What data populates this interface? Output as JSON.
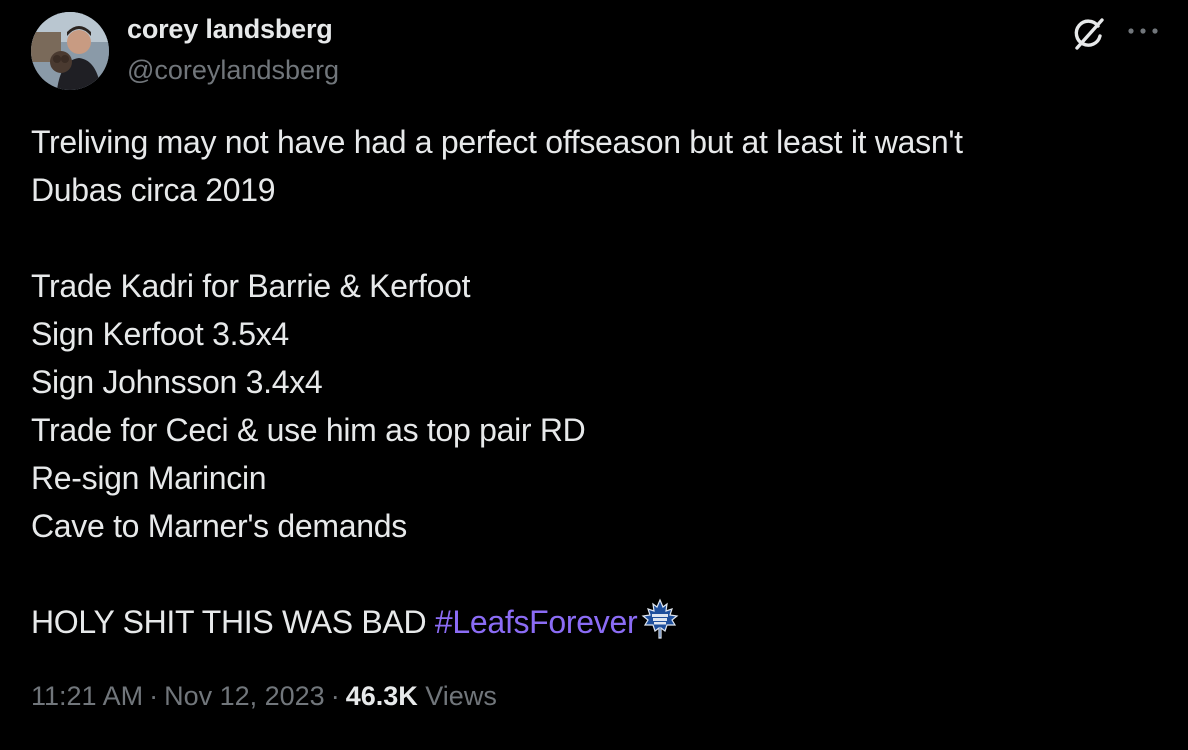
{
  "author": {
    "display_name": "corey landsberg",
    "handle": "@coreylandsberg",
    "avatar_icon": "profile-photo"
  },
  "actions": {
    "grok_icon": "grok-icon",
    "more_icon": "more-dots-icon"
  },
  "tweet": {
    "lines": [
      "Treliving may not have had a perfect offseason but at least it wasn't",
      "Dubas circa 2019",
      "",
      "Trade Kadri for Barrie & Kerfoot",
      "Sign Kerfoot 3.5x4",
      "Sign Johnsson 3.4x4",
      "Trade for Ceci & use him as top pair RD",
      "Re-sign Marincin",
      "Cave to Marner's demands",
      ""
    ],
    "last_line_text": "HOLY SHIT THIS WAS BAD ",
    "hashtag": "#LeafsForever",
    "hashflag_icon": "maple-leafs-logo-icon",
    "hashtag_color": "#8b6cf5"
  },
  "meta": {
    "time": "11:21 AM",
    "date": "Nov 12, 2023",
    "separator": "·",
    "views_count": "46.3K",
    "views_label": "Views"
  },
  "colors": {
    "background": "#000000",
    "primary_text": "#e7e9ea",
    "secondary_text": "#71767b"
  }
}
